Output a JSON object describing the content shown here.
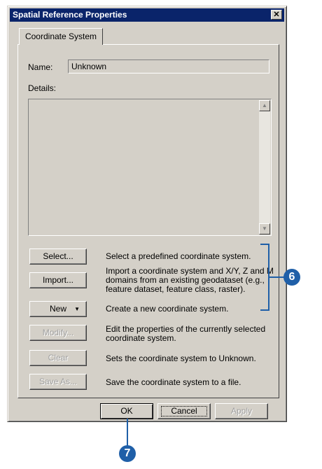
{
  "window": {
    "title": "Spatial Reference Properties",
    "close_glyph": "✕"
  },
  "tab": {
    "label": "Coordinate System"
  },
  "name": {
    "label": "Name:",
    "value": "Unknown"
  },
  "details": {
    "label": "Details:"
  },
  "actions": [
    {
      "label": "Select...",
      "description": "Select a predefined coordinate system.",
      "enabled": true
    },
    {
      "label": "Import...",
      "description": "Import a coordinate system and X/Y, Z and M domains from an existing geodataset (e.g., feature dataset, feature class, raster).",
      "enabled": true
    },
    {
      "label": "New",
      "description": "Create a new coordinate system.",
      "enabled": true
    },
    {
      "label": "Modify...",
      "description": "Edit the properties of the currently selected coordinate system.",
      "enabled": false
    },
    {
      "label": "Clear",
      "description": "Sets the coordinate system to Unknown.",
      "enabled": false
    },
    {
      "label": "Save As...",
      "description": "Save the coordinate system to a file.",
      "enabled": false
    }
  ],
  "footer": {
    "ok": "OK",
    "cancel": "Cancel",
    "apply": "Apply"
  },
  "callouts": {
    "six": "6",
    "seven": "7",
    "color": "#1f5fa8"
  }
}
